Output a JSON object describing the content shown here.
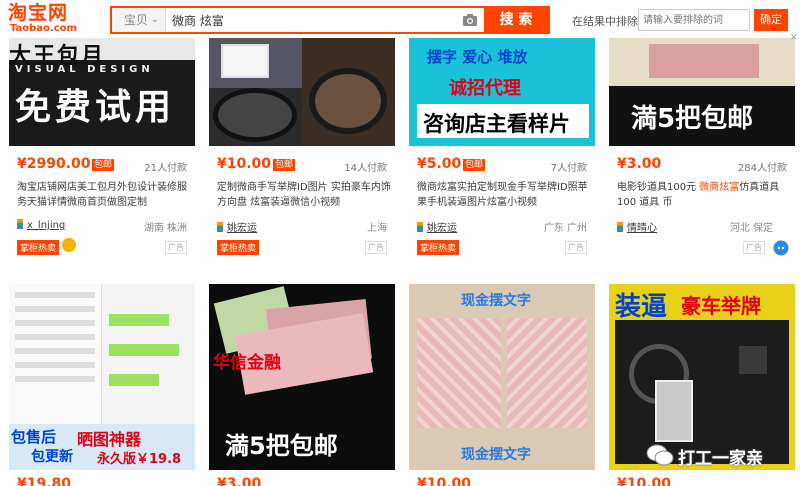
{
  "header": {
    "logo_main": "淘宝网",
    "logo_sub": "Taobao.com",
    "scope_label": "宝贝",
    "search_value": "微商 炫富",
    "search_button": "搜 索",
    "refine_label": "在结果中排除",
    "refine_placeholder": "请输入要排除的词",
    "confirm_button": "确定"
  },
  "items": [
    {
      "image_lines": [
        "VISUAL DESIGN",
        "免费试用"
      ],
      "price": "¥2990.00",
      "badge": "包邮",
      "paid": "21人付款",
      "title": "淘宝店铺网店美工包月外包设计装修服务天猫详情微商首页做图定制",
      "shop": "x_lnjing",
      "location": "湖南 株洲",
      "tag": "掌柜热卖",
      "ad": "广告"
    },
    {
      "image_lines": [],
      "price": "¥10.00",
      "badge": "包邮",
      "paid": "14人付款",
      "title": "定制微商手写举牌ID图片 实拍豪车内饰方向盘 炫富装逼微信小视频",
      "shop": "姚宏运",
      "location": "上海",
      "tag": "掌柜热卖",
      "ad": "广告"
    },
    {
      "image_lines": [
        "摆字 爱心 堆放",
        "诚招代理",
        "咨询店主看样片"
      ],
      "price": "¥5.00",
      "badge": "包邮",
      "paid": "7人付款",
      "title": "微商炫富实拍定制现金手写举牌ID照苹果手机装逼图片炫富小视频",
      "shop": "姚宏运",
      "location": "广东 广州",
      "tag": "掌柜热卖",
      "ad": "广告"
    },
    {
      "image_lines": [
        "満5把包邮"
      ],
      "price": "¥3.00",
      "badge": "",
      "paid": "284人付款",
      "title_parts": [
        "电影钞道具100元 ",
        "微商炫富",
        "仿真道具100 道具 币"
      ],
      "shop": "情晴心",
      "location": "河北 保定",
      "tag": "",
      "ad": "广告"
    },
    {
      "image_lines": [
        "包售后",
        "晒图神器",
        "包更新",
        "永久版￥19.8"
      ],
      "price": "¥19.80",
      "paid": "",
      "title": ""
    },
    {
      "image_lines": [
        "华信金融",
        "満5把包邮"
      ],
      "price": "¥3.00",
      "paid": "",
      "title": ""
    },
    {
      "image_lines": [
        "现金摆文字",
        "现金摆文字"
      ],
      "price": "¥10.00",
      "paid": "",
      "title": ""
    },
    {
      "image_lines": [
        "装逼",
        "豪车举牌"
      ],
      "price": "¥10.00",
      "paid": "",
      "title": ""
    }
  ],
  "watermark": "打工一家亲",
  "colors": {
    "accent": "#ff4400",
    "hot_tag": "#ff4400",
    "price": "#ff4400"
  },
  "icons": {
    "camera": "camera-icon",
    "close": "close-icon",
    "shop": "shop-icon",
    "wechat": "wechat-icon"
  }
}
